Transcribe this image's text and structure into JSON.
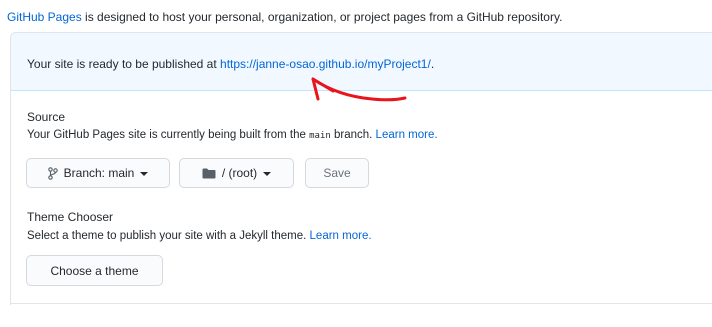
{
  "intro": {
    "link": "GitHub Pages",
    "text": " is designed to host your personal, organization, or project pages from a GitHub repository."
  },
  "flash": {
    "prefix": "Your site is ready to be published at ",
    "url": "https://janne-osao.github.io/myProject1/",
    "suffix": "."
  },
  "source": {
    "title": "Source",
    "desc_prefix": "Your GitHub Pages site is currently being built from the ",
    "branch_code": "main",
    "desc_suffix": " branch. ",
    "learn_more": "Learn more."
  },
  "buttons": {
    "branch": "Branch: main",
    "folder": "/ (root)",
    "save": "Save"
  },
  "theme": {
    "title": "Theme Chooser",
    "desc_prefix": "Select a theme to publish your site with a Jekyll theme. ",
    "learn_more": "Learn more.",
    "button": "Choose a theme"
  },
  "colors": {
    "link": "#0366d6",
    "flash_bg": "#f1f8ff",
    "annotation": "#e8151b"
  },
  "icons": [
    "git-branch-icon",
    "folder-icon",
    "caret-down-icon"
  ]
}
